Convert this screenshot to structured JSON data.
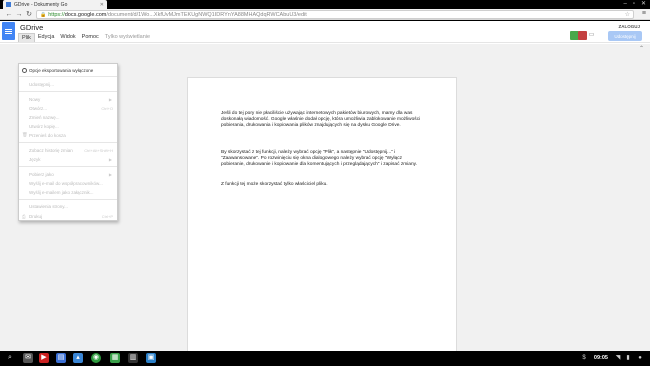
{
  "browser": {
    "tab_title": "GDrive - Dokumenty Go",
    "url_https": "https://",
    "url_host": "docs.google.com",
    "url_path": "/document/d/1Wo...XkfUvMJmTEKUgNWQ1IDRYnYA88MHAQdqRWCAbuU3/edit"
  },
  "app": {
    "doc_title": "GDrive",
    "menus": [
      "Plik",
      "Edycja",
      "Widok",
      "Pomoc"
    ],
    "menu_hint": "Tylko wyświetlanie",
    "signin": "ZALOGUJ",
    "share_label": "Udostępnij"
  },
  "file_menu": {
    "items": [
      {
        "label": "Opcje eksportowania wyłączone",
        "shortcut": "",
        "arrow": false,
        "enabled": true
      },
      {
        "label": "Udostępnij...",
        "shortcut": "",
        "arrow": false,
        "enabled": false
      },
      {
        "label": "Nowy",
        "shortcut": "",
        "arrow": true,
        "enabled": false
      },
      {
        "label": "Otwórz...",
        "shortcut": "Ctrl+O",
        "arrow": false,
        "enabled": false
      },
      {
        "label": "Zmień nazwę...",
        "shortcut": "",
        "arrow": false,
        "enabled": false
      },
      {
        "label": "Utwórz kopię...",
        "shortcut": "",
        "arrow": false,
        "enabled": false
      },
      {
        "label": "Przenieś do kosza",
        "shortcut": "",
        "arrow": false,
        "enabled": false
      },
      {
        "label": "Zobacz historię zmian",
        "shortcut": "Ctrl+Alt+Shift+H",
        "arrow": false,
        "enabled": false
      },
      {
        "label": "Język",
        "shortcut": "",
        "arrow": true,
        "enabled": false
      },
      {
        "label": "Pobierz jako",
        "shortcut": "",
        "arrow": true,
        "enabled": false
      },
      {
        "label": "Wyślij e-mail do współpracowników...",
        "shortcut": "",
        "arrow": false,
        "enabled": false
      },
      {
        "label": "Wyślij e-mailem jako załącznik...",
        "shortcut": "",
        "arrow": false,
        "enabled": false
      },
      {
        "label": "Ustawienia strony...",
        "shortcut": "",
        "arrow": false,
        "enabled": false
      },
      {
        "label": "Drukuj",
        "shortcut": "Ctrl+P",
        "arrow": false,
        "enabled": false
      }
    ]
  },
  "document": {
    "paragraphs": [
      "Jeśli do tej pory nie płaciliście używając internetowych pakietów biurowych, mamy dla was doskonałą wiadomość. Google właśnie dodał opcję, która umożliwia zablokowanie możliwości pobierania, drukowania i kopiowania plików znajdujących się na dysku Google Drive.",
      "By skorzystać z tej funkcji, należy wybrać opcję \"Plik\", a następnie \"Udostępnij...\" i \"Zaawansowane\". Po rozwinięciu się okna dialogowego należy wybrać opcję \"Wyłącz pobieranie, drukowanie i kopiowanie dla komentujących i przeglądających\" i zapisać zmiany.",
      "Z funkcji tej może skorzystać tylko właściciel pliku."
    ]
  },
  "taskbar": {
    "clock": "09:05"
  },
  "colors": {
    "accent": "#4285f4",
    "share": "#a9c8f5"
  }
}
